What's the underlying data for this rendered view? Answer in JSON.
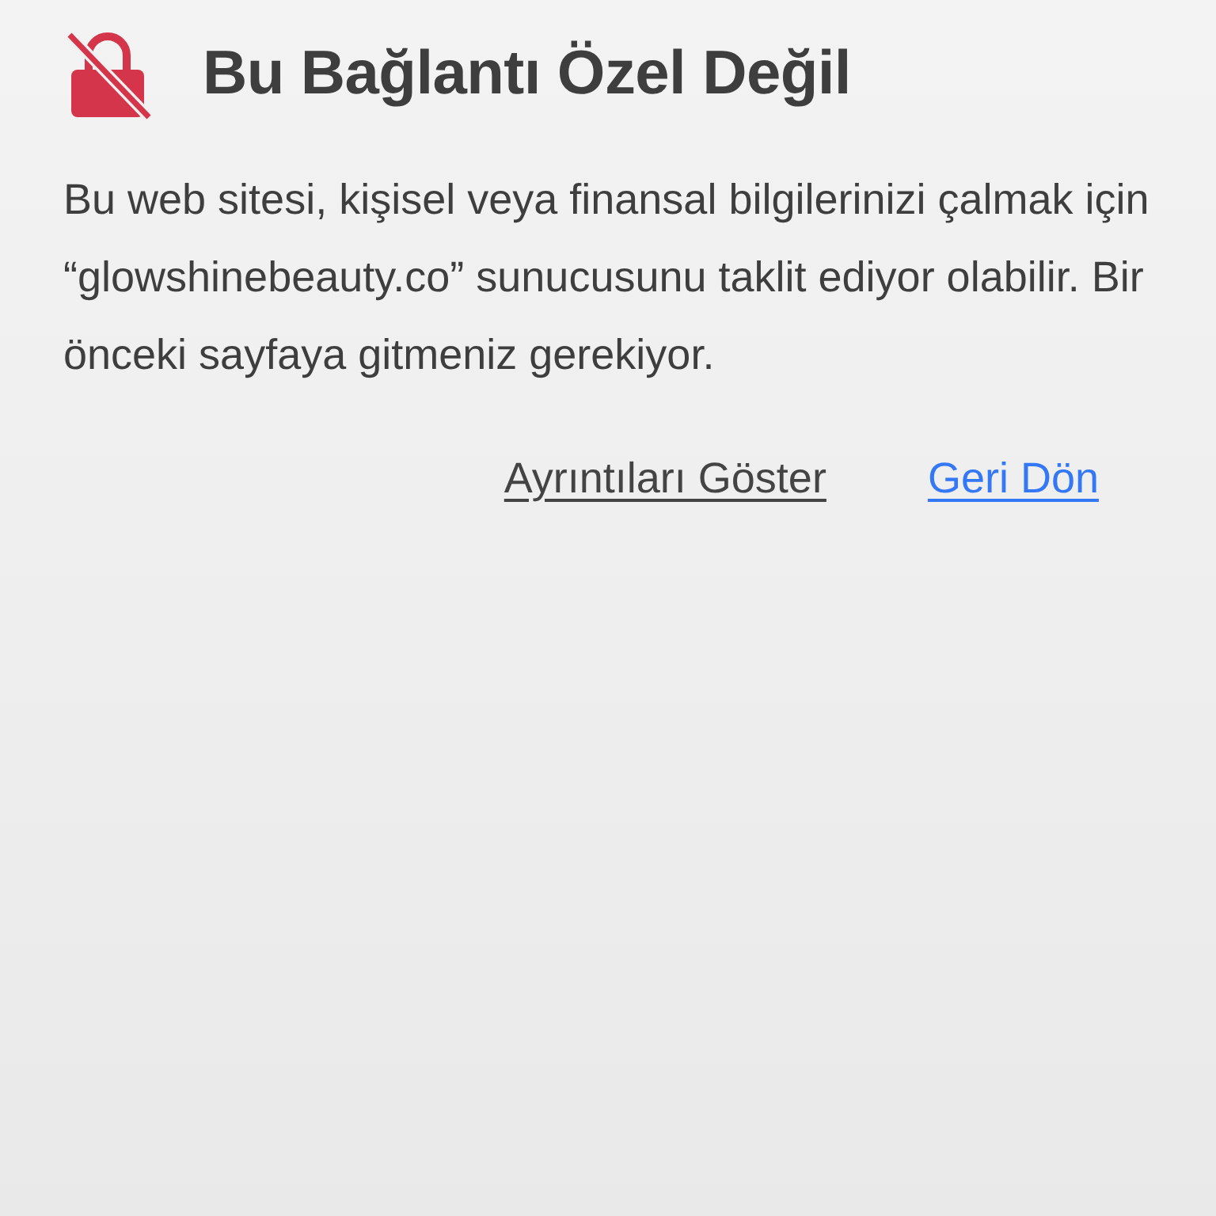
{
  "warning": {
    "title": "Bu Bağlantı Özel Değil",
    "message": "Bu web sitesi, kişisel veya finansal bilgilerinizi çalmak için “glowshinebeauty.co” sunucusunu taklit ediyor olabilir. Bir önceki sayfaya gitmeniz gerekiyor.",
    "links": [
      {
        "label": "Ayrıntıları Göster",
        "kind": "secondary"
      },
      {
        "label": "Geri Dön",
        "kind": "primary"
      }
    ]
  }
}
